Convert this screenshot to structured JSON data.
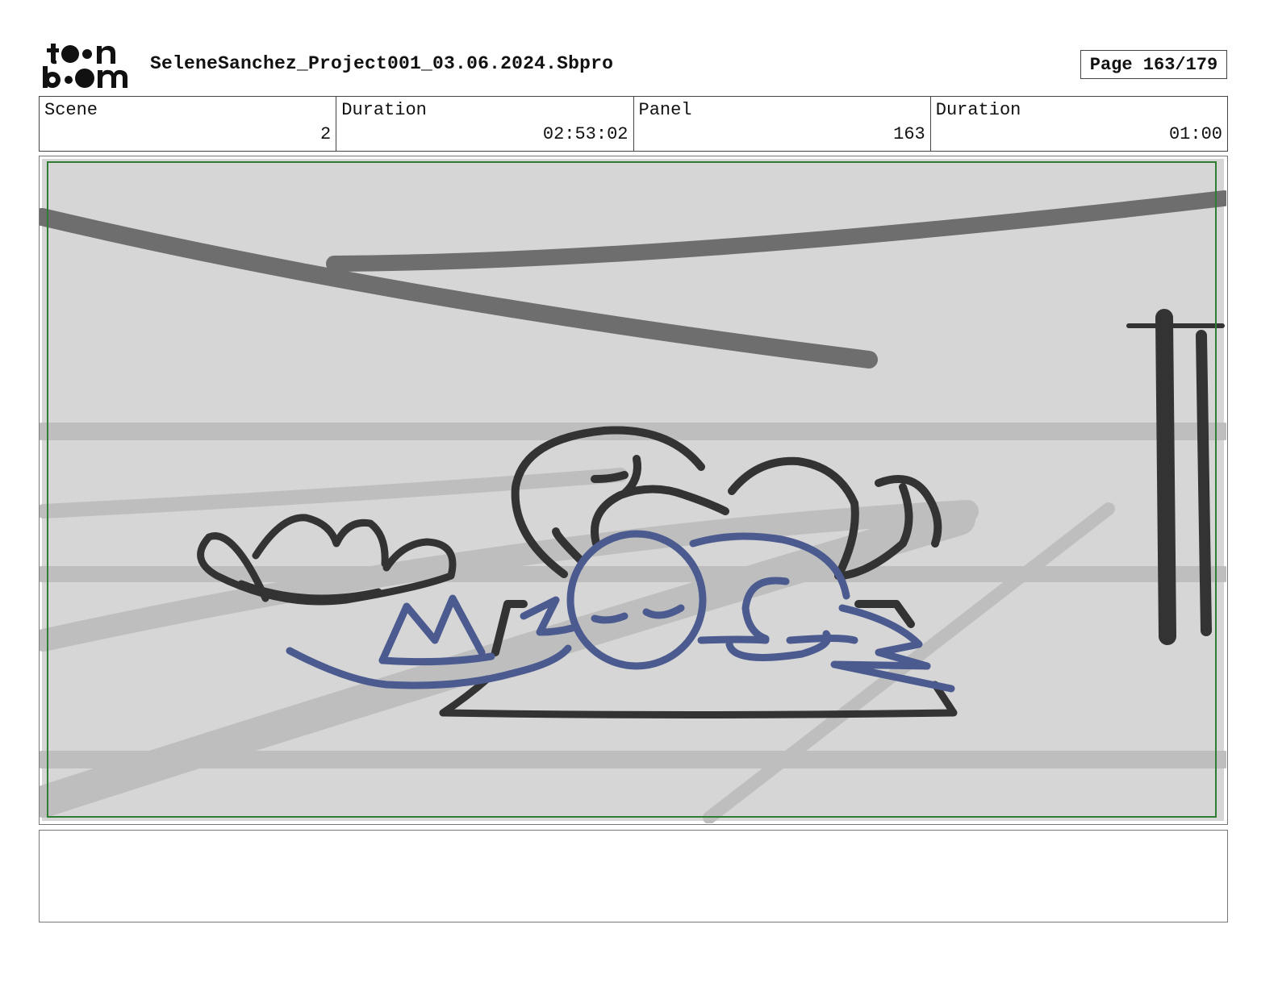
{
  "header": {
    "filename": "SeleneSanchez_Project001_03.06.2024.Sbpro",
    "page_label": "Page 163/179"
  },
  "logo": {
    "icon": "toon-boom-logo",
    "text": "toon boom"
  },
  "info": {
    "scene_label": "Scene",
    "scene_value": "2",
    "scene_duration_label": "Duration",
    "scene_duration_value": "02:53:02",
    "panel_label": "Panel",
    "panel_value": "163",
    "panel_duration_label": "Duration",
    "panel_duration_value": "01:00"
  },
  "panel": {
    "background_color": "#d6d6d6",
    "safe_frame_color": "#2e7d32",
    "ink_color": "#333333",
    "character_color": "#4b5a8f"
  },
  "notes": {
    "text": ""
  }
}
